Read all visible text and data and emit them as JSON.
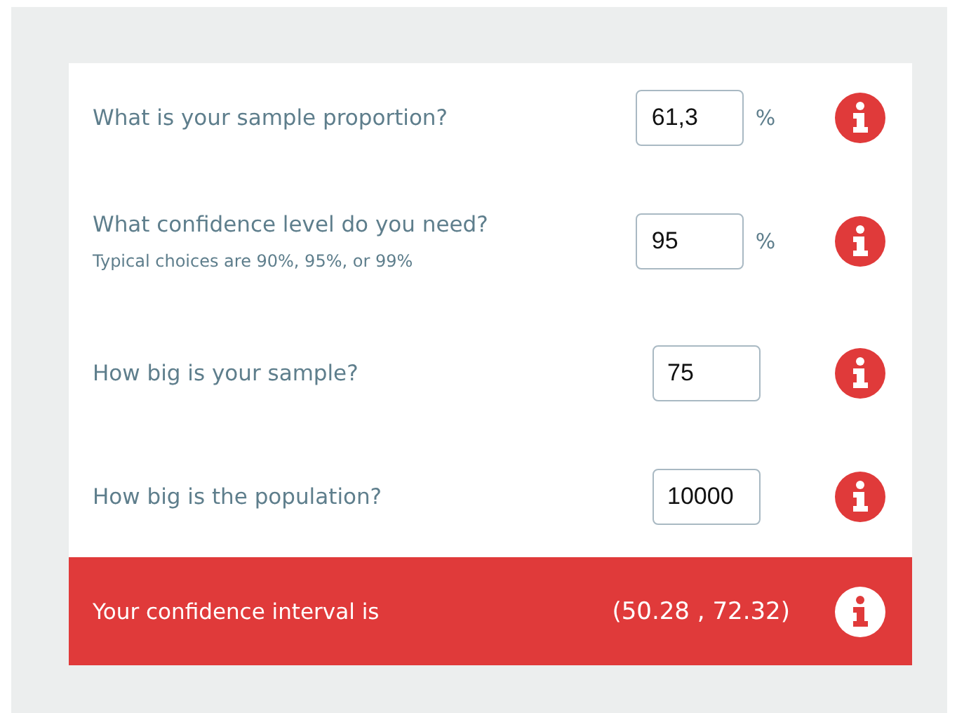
{
  "questions": [
    {
      "label": "What is your sample proportion?",
      "value": "61,3",
      "unit": "%"
    },
    {
      "label": "What confidence level do you need?",
      "hint": "Typical choices are 90%, 95%, or 99%",
      "value": "95",
      "unit": "%"
    },
    {
      "label": "How big is your sample?",
      "value": "75"
    },
    {
      "label": "How big is the population?",
      "value": "10000"
    }
  ],
  "result": {
    "label": "Your confidence interval is",
    "value": "(50.28 , 72.32)"
  }
}
